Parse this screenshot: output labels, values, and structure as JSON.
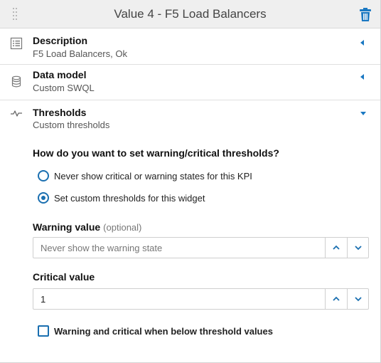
{
  "header": {
    "title": "Value 4 - F5 Load Balancers",
    "drag_icon": "drag-handle-icon",
    "delete_icon": "trash-icon"
  },
  "sections": {
    "description": {
      "title": "Description",
      "subtitle": "F5 Load Balancers, Ok",
      "icon": "list-icon",
      "expanded": false
    },
    "data_model": {
      "title": "Data model",
      "subtitle": "Custom SWQL",
      "icon": "database-icon",
      "expanded": false
    },
    "thresholds": {
      "title": "Thresholds",
      "subtitle": "Custom thresholds",
      "icon": "pulse-icon",
      "expanded": true
    }
  },
  "thresholds_form": {
    "question": "How do you want to set warning/critical thresholds?",
    "options": [
      {
        "label": "Never show critical or warning states for this KPI",
        "selected": false
      },
      {
        "label": "Set custom thresholds for this widget",
        "selected": true
      }
    ],
    "warning": {
      "label": "Warning value",
      "optional": "(optional)",
      "value": "",
      "placeholder": "Never show the warning state"
    },
    "critical": {
      "label": "Critical value",
      "value": "1",
      "placeholder": ""
    },
    "below_checkbox": {
      "label": "Warning and critical when below threshold values",
      "checked": false
    }
  },
  "colors": {
    "accent": "#1a6fb0",
    "header_bg": "#efefef"
  }
}
